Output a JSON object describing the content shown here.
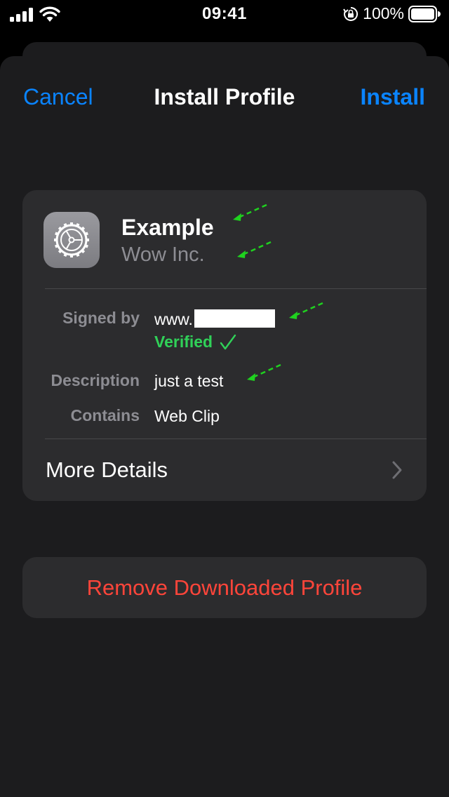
{
  "status_bar": {
    "time": "09:41",
    "battery": "100%",
    "icons": [
      "signal-icon",
      "wifi-icon",
      "orientation-lock-icon",
      "battery-icon"
    ]
  },
  "nav": {
    "cancel": "Cancel",
    "title": "Install Profile",
    "install": "Install"
  },
  "profile": {
    "name": "Example",
    "organization": "Wow Inc.",
    "icon": "settings-gear-icon"
  },
  "details": {
    "signed_by_label": "Signed by",
    "signed_by_value": "www.",
    "verified_label": "Verified",
    "description_label": "Description",
    "description_value": "just a test",
    "contains_label": "Contains",
    "contains_value": "Web Clip"
  },
  "more_details": "More Details",
  "remove_profile": "Remove Downloaded Profile",
  "colors": {
    "accent": "#0a84ff",
    "verified": "#30d158",
    "destructive": "#ff453a",
    "annotation": "#1fd21f"
  }
}
